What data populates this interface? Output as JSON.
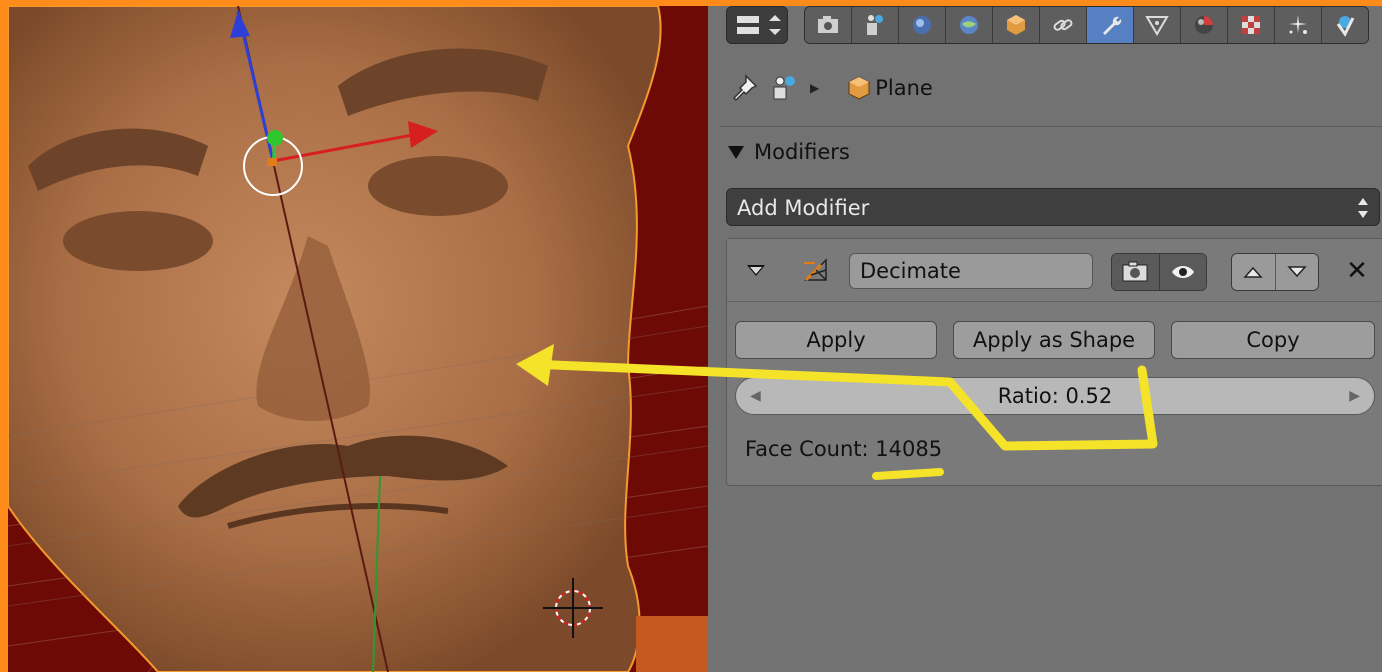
{
  "header": {
    "editor_type_icon": "editor-type-icon",
    "tabs": [
      {
        "name": "render-icon"
      },
      {
        "name": "render-layers-icon"
      },
      {
        "name": "scene-icon"
      },
      {
        "name": "world-icon"
      },
      {
        "name": "object-icon"
      },
      {
        "name": "constraints-icon"
      },
      {
        "name": "modifiers-icon",
        "active": true
      },
      {
        "name": "data-icon"
      },
      {
        "name": "material-icon"
      },
      {
        "name": "texture-icon"
      },
      {
        "name": "particles-icon"
      },
      {
        "name": "physics-icon"
      }
    ]
  },
  "breadcrumb": {
    "object_name": "Plane"
  },
  "modifiers": {
    "section_label": "Modifiers",
    "add_modifier_label": "Add Modifier",
    "decimate": {
      "name": "Decimate",
      "apply_label": "Apply",
      "apply_shape_label": "Apply as Shape",
      "copy_label": "Copy",
      "ratio_label": "Ratio: 0.52",
      "ratio": 0.52,
      "face_count_label": "Face Count: 14085"
    }
  },
  "colors": {
    "accent_active_tab": "#5680c2",
    "annotation": "#f5e32a",
    "frame": "#ff8c1a",
    "selection_outline": "#f59a2c"
  }
}
